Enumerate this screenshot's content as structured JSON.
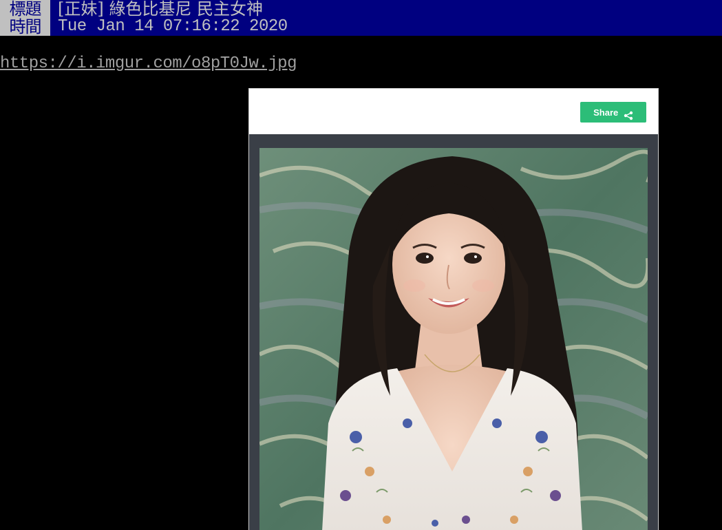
{
  "header": {
    "title_tag": "標題",
    "title_value": "[正妹] 綠色比基尼 民主女神",
    "time_tag": "時間",
    "time_value": "Tue Jan 14 07:16:22 2020"
  },
  "body": {
    "link_text": "https://i.imgur.com/o8pT0Jw.jpg"
  },
  "embed": {
    "share_label": "Share",
    "share_icon": "share-icon",
    "photo_description_icon": "photo-image",
    "colors": {
      "share_button": "#2cbd78",
      "embed_frame": "#3a3f47"
    }
  },
  "colors": {
    "header_bg": "#000080",
    "tag_bg": "#c0c0c0",
    "page_bg": "#000000"
  }
}
